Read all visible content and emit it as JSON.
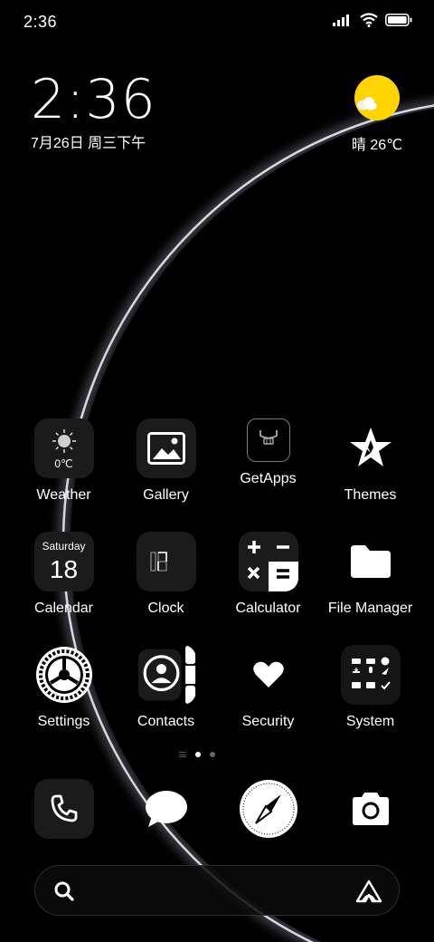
{
  "status_bar": {
    "time": "2:36",
    "icons": [
      "signal-icon",
      "wifi-icon",
      "battery-icon"
    ]
  },
  "clock_widget": {
    "time": "2:36",
    "date": "7月26日 周三下午"
  },
  "weather_widget": {
    "icon": "sun-cloud-icon",
    "text": "晴 26℃"
  },
  "apps": [
    [
      {
        "label": "Weather",
        "icon": "weather-icon",
        "temp": "0℃"
      },
      {
        "label": "Gallery",
        "icon": "gallery-icon"
      },
      {
        "label": "GetApps",
        "icon": "getapps-icon"
      },
      {
        "label": "Themes",
        "icon": "themes-icon"
      }
    ],
    [
      {
        "label": "Calendar",
        "icon": "calendar-icon",
        "day": "Saturday",
        "date": "18"
      },
      {
        "label": "Clock",
        "icon": "clock-icon"
      },
      {
        "label": "Calculator",
        "icon": "calculator-icon"
      },
      {
        "label": "File Manager",
        "icon": "folder-icon"
      }
    ],
    [
      {
        "label": "Settings",
        "icon": "settings-icon"
      },
      {
        "label": "Contacts",
        "icon": "contacts-icon"
      },
      {
        "label": "Security",
        "icon": "security-icon"
      },
      {
        "label": "System",
        "icon": "system-folder-icon"
      }
    ]
  ],
  "dock": [
    {
      "icon": "phone-icon"
    },
    {
      "icon": "messages-icon"
    },
    {
      "icon": "browser-compass-icon"
    },
    {
      "icon": "camera-icon"
    }
  ],
  "page_indicator": {
    "pages": 2,
    "active": 1
  },
  "search_bar": {
    "icons": [
      "search-icon",
      "assistant-icon"
    ]
  },
  "colors": {
    "background": "#000000",
    "sun": "#FFD400",
    "text": "#FFFFFF"
  }
}
